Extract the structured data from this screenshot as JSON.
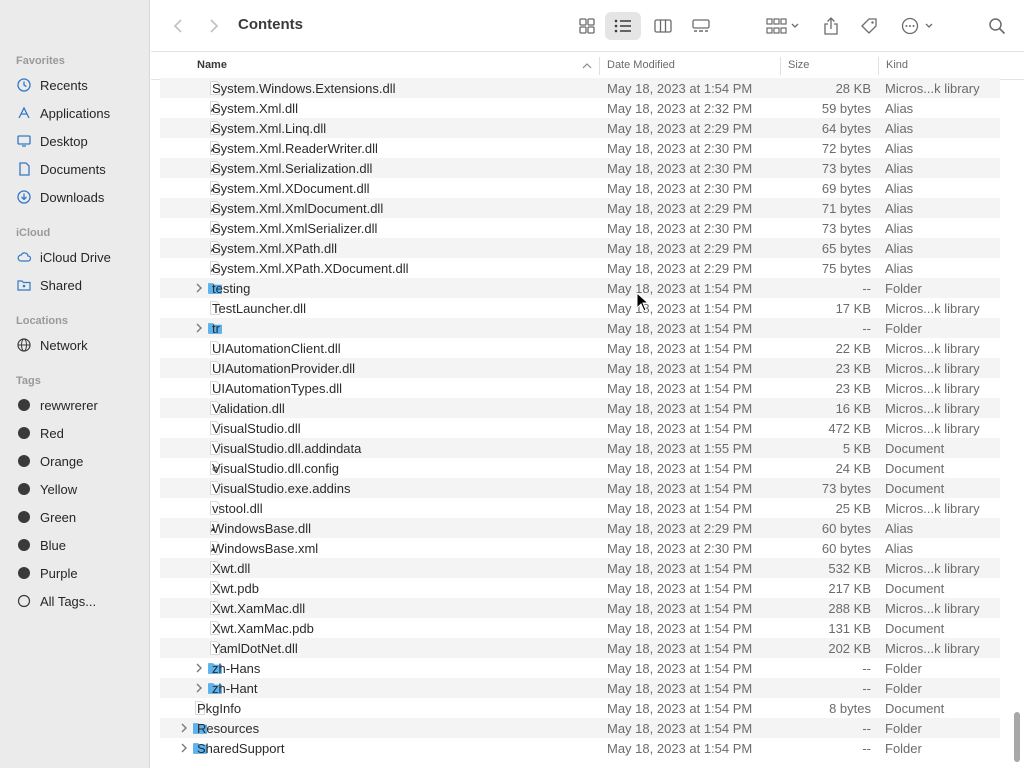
{
  "window": {
    "title": "Contents"
  },
  "sidebar": {
    "favorites_label": "Favorites",
    "favorites": [
      {
        "label": "Recents",
        "icon": "clock-icon"
      },
      {
        "label": "Applications",
        "icon": "applications-icon"
      },
      {
        "label": "Desktop",
        "icon": "desktop-icon"
      },
      {
        "label": "Documents",
        "icon": "document-icon"
      },
      {
        "label": "Downloads",
        "icon": "download-icon"
      }
    ],
    "icloud_label": "iCloud",
    "icloud": [
      {
        "label": "iCloud Drive",
        "icon": "cloud-icon"
      },
      {
        "label": "Shared",
        "icon": "shared-folder-icon"
      }
    ],
    "locations_label": "Locations",
    "locations": [
      {
        "label": "Network",
        "icon": "globe-icon"
      }
    ],
    "tags_label": "Tags",
    "tags": [
      {
        "label": "rewwrerer"
      },
      {
        "label": "Red"
      },
      {
        "label": "Orange"
      },
      {
        "label": "Yellow"
      },
      {
        "label": "Green"
      },
      {
        "label": "Blue"
      },
      {
        "label": "Purple"
      }
    ],
    "all_tags": "All Tags..."
  },
  "columns": {
    "name": "Name",
    "date": "Date Modified",
    "size": "Size",
    "kind": "Kind"
  },
  "files": [
    {
      "name": "System.Windows.Extensions.dll",
      "date": "May 18, 2023 at 1:54 PM",
      "size": "28 KB",
      "kind": "Micros...k library",
      "type": "file",
      "indent": 1
    },
    {
      "name": "System.Xml.dll",
      "date": "May 18, 2023 at 2:32 PM",
      "size": "59 bytes",
      "kind": "Alias",
      "type": "alias",
      "indent": 1
    },
    {
      "name": "System.Xml.Linq.dll",
      "date": "May 18, 2023 at 2:29 PM",
      "size": "64 bytes",
      "kind": "Alias",
      "type": "alias",
      "indent": 1
    },
    {
      "name": "System.Xml.ReaderWriter.dll",
      "date": "May 18, 2023 at 2:30 PM",
      "size": "72 bytes",
      "kind": "Alias",
      "type": "alias",
      "indent": 1
    },
    {
      "name": "System.Xml.Serialization.dll",
      "date": "May 18, 2023 at 2:30 PM",
      "size": "73 bytes",
      "kind": "Alias",
      "type": "alias",
      "indent": 1
    },
    {
      "name": "System.Xml.XDocument.dll",
      "date": "May 18, 2023 at 2:30 PM",
      "size": "69 bytes",
      "kind": "Alias",
      "type": "alias",
      "indent": 1
    },
    {
      "name": "System.Xml.XmlDocument.dll",
      "date": "May 18, 2023 at 2:29 PM",
      "size": "71 bytes",
      "kind": "Alias",
      "type": "alias",
      "indent": 1
    },
    {
      "name": "System.Xml.XmlSerializer.dll",
      "date": "May 18, 2023 at 2:30 PM",
      "size": "73 bytes",
      "kind": "Alias",
      "type": "alias",
      "indent": 1
    },
    {
      "name": "System.Xml.XPath.dll",
      "date": "May 18, 2023 at 2:29 PM",
      "size": "65 bytes",
      "kind": "Alias",
      "type": "alias",
      "indent": 1
    },
    {
      "name": "System.Xml.XPath.XDocument.dll",
      "date": "May 18, 2023 at 2:29 PM",
      "size": "75 bytes",
      "kind": "Alias",
      "type": "alias",
      "indent": 1
    },
    {
      "name": "testing",
      "date": "May 18, 2023 at 1:54 PM",
      "size": "--",
      "kind": "Folder",
      "type": "folder",
      "indent": 1
    },
    {
      "name": "TestLauncher.dll",
      "date": "May 18, 2023 at 1:54 PM",
      "size": "17 KB",
      "kind": "Micros...k library",
      "type": "file",
      "indent": 1
    },
    {
      "name": "tr",
      "date": "May 18, 2023 at 1:54 PM",
      "size": "--",
      "kind": "Folder",
      "type": "folder",
      "indent": 1
    },
    {
      "name": "UIAutomationClient.dll",
      "date": "May 18, 2023 at 1:54 PM",
      "size": "22 KB",
      "kind": "Micros...k library",
      "type": "file",
      "indent": 1
    },
    {
      "name": "UIAutomationProvider.dll",
      "date": "May 18, 2023 at 1:54 PM",
      "size": "23 KB",
      "kind": "Micros...k library",
      "type": "file",
      "indent": 1
    },
    {
      "name": "UIAutomationTypes.dll",
      "date": "May 18, 2023 at 1:54 PM",
      "size": "23 KB",
      "kind": "Micros...k library",
      "type": "file",
      "indent": 1
    },
    {
      "name": "Validation.dll",
      "date": "May 18, 2023 at 1:54 PM",
      "size": "16 KB",
      "kind": "Micros...k library",
      "type": "file",
      "indent": 1
    },
    {
      "name": "VisualStudio.dll",
      "date": "May 18, 2023 at 1:54 PM",
      "size": "472 KB",
      "kind": "Micros...k library",
      "type": "file",
      "indent": 1
    },
    {
      "name": "VisualStudio.dll.addindata",
      "date": "May 18, 2023 at 1:55 PM",
      "size": "5 KB",
      "kind": "Document",
      "type": "file",
      "indent": 1
    },
    {
      "name": "VisualStudio.dll.config",
      "date": "May 18, 2023 at 1:54 PM",
      "size": "24 KB",
      "kind": "Document",
      "type": "config",
      "indent": 1
    },
    {
      "name": "VisualStudio.exe.addins",
      "date": "May 18, 2023 at 1:54 PM",
      "size": "73 bytes",
      "kind": "Document",
      "type": "file",
      "indent": 1
    },
    {
      "name": "vstool.dll",
      "date": "May 18, 2023 at 1:54 PM",
      "size": "25 KB",
      "kind": "Micros...k library",
      "type": "file",
      "indent": 1
    },
    {
      "name": "WindowsBase.dll",
      "date": "May 18, 2023 at 2:29 PM",
      "size": "60 bytes",
      "kind": "Alias",
      "type": "alias",
      "indent": 1
    },
    {
      "name": "WindowsBase.xml",
      "date": "May 18, 2023 at 2:30 PM",
      "size": "60 bytes",
      "kind": "Alias",
      "type": "alias",
      "indent": 1
    },
    {
      "name": "Xwt.dll",
      "date": "May 18, 2023 at 1:54 PM",
      "size": "532 KB",
      "kind": "Micros...k library",
      "type": "file",
      "indent": 1
    },
    {
      "name": "Xwt.pdb",
      "date": "May 18, 2023 at 1:54 PM",
      "size": "217 KB",
      "kind": "Document",
      "type": "file",
      "indent": 1
    },
    {
      "name": "Xwt.XamMac.dll",
      "date": "May 18, 2023 at 1:54 PM",
      "size": "288 KB",
      "kind": "Micros...k library",
      "type": "file",
      "indent": 1
    },
    {
      "name": "Xwt.XamMac.pdb",
      "date": "May 18, 2023 at 1:54 PM",
      "size": "131 KB",
      "kind": "Document",
      "type": "file",
      "indent": 1
    },
    {
      "name": "YamlDotNet.dll",
      "date": "May 18, 2023 at 1:54 PM",
      "size": "202 KB",
      "kind": "Micros...k library",
      "type": "file",
      "indent": 1
    },
    {
      "name": "zh-Hans",
      "date": "May 18, 2023 at 1:54 PM",
      "size": "--",
      "kind": "Folder",
      "type": "folder",
      "indent": 1
    },
    {
      "name": "zh-Hant",
      "date": "May 18, 2023 at 1:54 PM",
      "size": "--",
      "kind": "Folder",
      "type": "folder",
      "indent": 1
    },
    {
      "name": "PkgInfo",
      "date": "May 18, 2023 at 1:54 PM",
      "size": "8 bytes",
      "kind": "Document",
      "type": "file",
      "indent": 0
    },
    {
      "name": "Resources",
      "date": "May 18, 2023 at 1:54 PM",
      "size": "--",
      "kind": "Folder",
      "type": "folder",
      "indent": 0
    },
    {
      "name": "SharedSupport",
      "date": "May 18, 2023 at 1:54 PM",
      "size": "--",
      "kind": "Folder",
      "type": "folder",
      "indent": 0
    }
  ],
  "colors": {
    "folder_blue": "#5bb4f0",
    "sidebar_bg": "#ebebeb",
    "stripe": "#f4f4f4"
  }
}
